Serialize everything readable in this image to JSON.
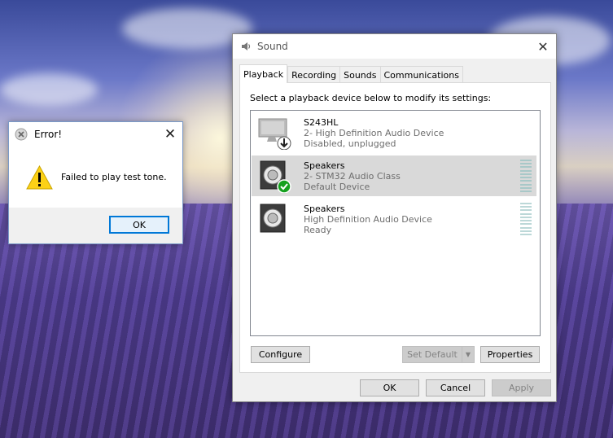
{
  "error_dialog": {
    "title": "Error!",
    "close_glyph": "✕",
    "message": "Failed to play test tone.",
    "ok_label": "OK",
    "icons": {
      "title": "error-x-icon",
      "body": "warning-triangle-icon"
    }
  },
  "sound_dialog": {
    "title": "Sound",
    "close_glyph": "✕",
    "tabs": [
      {
        "label": "Playback",
        "active": true
      },
      {
        "label": "Recording",
        "active": false
      },
      {
        "label": "Sounds",
        "active": false
      },
      {
        "label": "Communications",
        "active": false
      }
    ],
    "instruction": "Select a playback device below to modify its settings:",
    "devices": [
      {
        "name": "S243HL",
        "description": "2- High Definition Audio Device",
        "status": "Disabled, unplugged",
        "icon": "monitor-icon",
        "badge": "down-arrow-badge",
        "selected": false
      },
      {
        "name": "Speakers",
        "description": "2- STM32 Audio Class",
        "status": "Default Device",
        "icon": "speaker-icon",
        "badge": "green-check-badge",
        "selected": true
      },
      {
        "name": "Speakers",
        "description": "High Definition Audio Device",
        "status": "Ready",
        "icon": "speaker-icon",
        "badge": null,
        "selected": false
      }
    ],
    "buttons": {
      "configure": "Configure",
      "set_default": "Set Default",
      "properties": "Properties",
      "ok": "OK",
      "cancel": "Cancel",
      "apply": "Apply"
    }
  },
  "colors": {
    "accent": "#0078d7",
    "selection": "#d9d9d9",
    "check_green": "#14a01e"
  }
}
